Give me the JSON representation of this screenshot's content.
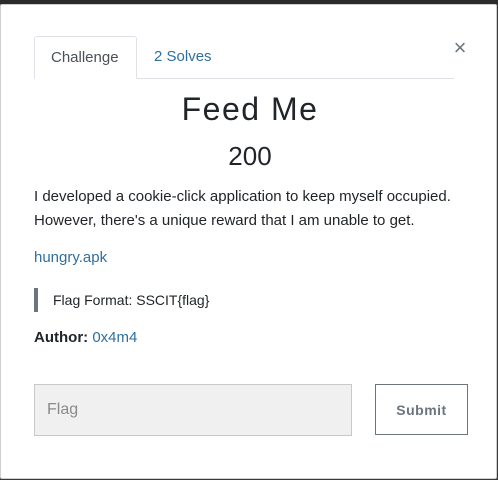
{
  "modal": {
    "close_glyph": "×",
    "tabs": [
      {
        "label": "Challenge",
        "active": true
      },
      {
        "label": "2 Solves",
        "active": false
      }
    ],
    "title": "Feed Me",
    "points": "200",
    "description": "I developed a cookie-click application to keep myself occupied. However, there's a unique reward that I am unable to get.",
    "file_link": "hungry.apk",
    "flag_format": "Flag Format: SSCIT{flag}",
    "author_label": "Author:",
    "author_name": "0x4m4",
    "flag_input": {
      "placeholder": "Flag",
      "value": ""
    },
    "submit_label": "Submit"
  },
  "colors": {
    "link": "#2f6fa0",
    "submit_border": "#6c757d",
    "input_bg": "#f0f0f0"
  }
}
